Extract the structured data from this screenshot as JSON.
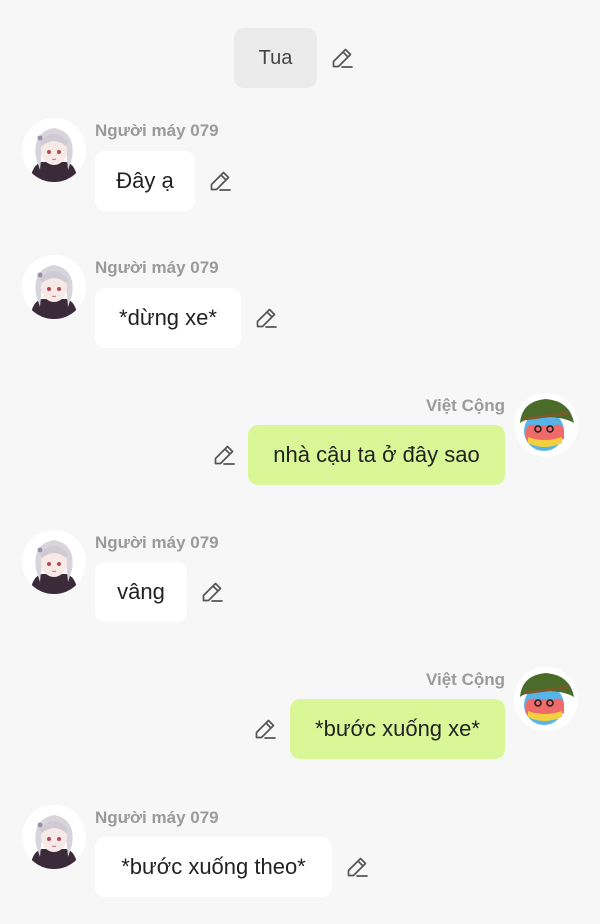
{
  "system_message": {
    "text": "Tua"
  },
  "messages": [
    {
      "sender": "Người máy 079",
      "text": "Đây ạ",
      "side": "left"
    },
    {
      "sender": "Người máy 079",
      "text": "*dừng xe*",
      "side": "left"
    },
    {
      "sender": "Việt Cộng",
      "text": "nhà cậu ta ở đây sao",
      "side": "right"
    },
    {
      "sender": "Người máy 079",
      "text": "vâng",
      "side": "left"
    },
    {
      "sender": "Việt Cộng",
      "text": "*bước xuống xe*",
      "side": "right"
    },
    {
      "sender": "Người máy 079",
      "text": "*bước xuống theo*",
      "side": "left"
    }
  ],
  "colors": {
    "background": "#f7f7f7",
    "incoming_bubble": "#ffffff",
    "outgoing_bubble": "#d9f797",
    "system_bubble": "#ebebeb",
    "sender_name": "#9a9a9a"
  },
  "icons": {
    "edit": "pencil-edit-icon",
    "left_avatar": "robot-girl-avatar",
    "right_avatar": "helmet-ball-avatar"
  }
}
